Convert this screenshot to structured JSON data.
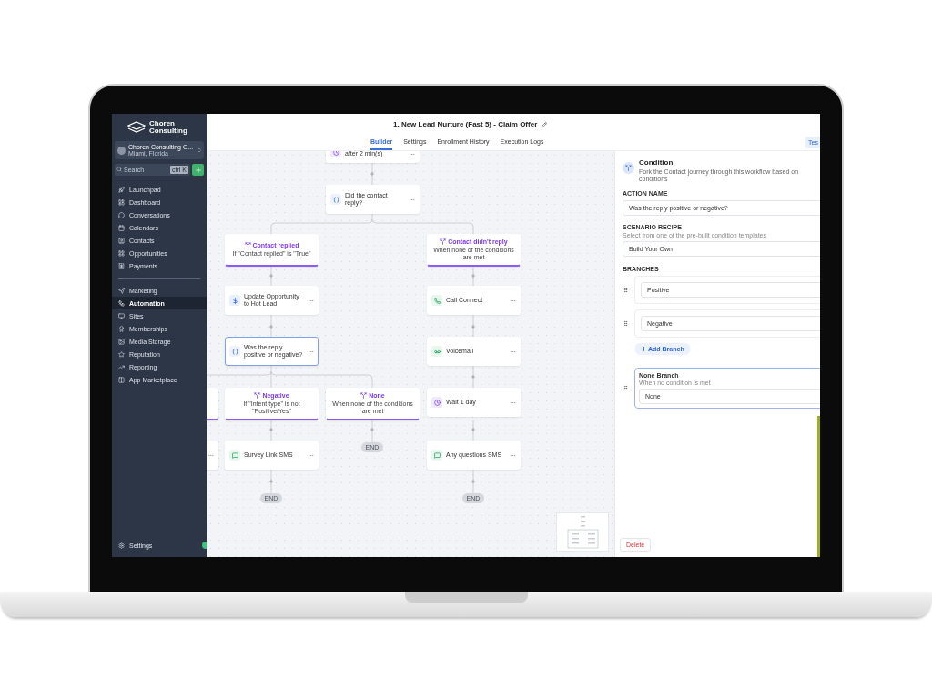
{
  "sidebar": {
    "brand": "Choren Consulting",
    "account": {
      "name": "Choren Consulting G...",
      "location": "Miami, Florida"
    },
    "search": {
      "placeholder": "Search",
      "shortcut": "ctrl K"
    },
    "nav_sections": [
      {
        "items": [
          {
            "label": "Launchpad",
            "selected": false
          },
          {
            "label": "Dashboard",
            "selected": false
          },
          {
            "label": "Conversations",
            "selected": false
          },
          {
            "label": "Calendars",
            "selected": false
          },
          {
            "label": "Contacts",
            "selected": false
          },
          {
            "label": "Opportunities",
            "selected": false
          },
          {
            "label": "Payments",
            "selected": false
          }
        ]
      },
      {
        "items": [
          {
            "label": "Marketing",
            "selected": false
          },
          {
            "label": "Automation",
            "selected": true
          },
          {
            "label": "Sites",
            "selected": false
          },
          {
            "label": "Memberships",
            "selected": false
          },
          {
            "label": "Media Storage",
            "selected": false
          },
          {
            "label": "Reputation",
            "selected": false
          },
          {
            "label": "Reporting",
            "selected": false
          },
          {
            "label": "App Marketplace",
            "selected": false
          }
        ]
      }
    ],
    "footer": {
      "label": "Settings"
    }
  },
  "header": {
    "title": "1. New Lead Nurture (Fast 5) - Claim Offer",
    "tabs": [
      {
        "label": "Builder",
        "selected": true
      },
      {
        "label": "Settings",
        "selected": false
      },
      {
        "label": "Enrollment History",
        "selected": false
      },
      {
        "label": "Execution Logs",
        "selected": false
      }
    ],
    "action": "Tes"
  },
  "canvas": {
    "nodes": [
      {
        "kind": "wait",
        "text": "after 2 min(s)",
        "selected": false
      },
      {
        "kind": "condition",
        "text": "Did the contact reply?",
        "selected": false
      },
      {
        "kind": "branch",
        "title": "Contact replied",
        "subtitle": "If \"Contact replied\" is \"True\"",
        "selected": false
      },
      {
        "kind": "branch",
        "title": "Contact didn't reply",
        "subtitle": "When none of the conditions are met",
        "selected": false
      },
      {
        "kind": "opportunity",
        "text": "Update Opportunity to Hot Lead",
        "selected": false
      },
      {
        "kind": "call",
        "text": "Call Connect",
        "selected": false
      },
      {
        "kind": "condition",
        "text": "Was the reply positive or negative?",
        "selected": true
      },
      {
        "kind": "voicemail",
        "text": "Voicemail",
        "selected": false
      },
      {
        "kind": "branch",
        "selected": false
      },
      {
        "kind": "branch",
        "title": "Negative",
        "subtitle": "If \"Intent type\" is not \"Positive/Yes\"",
        "selected": false
      },
      {
        "kind": "branch",
        "title": "None",
        "subtitle": "When none of the conditions are met",
        "selected": false
      },
      {
        "kind": "wait",
        "text": "Wait 1 day",
        "selected": false
      },
      {
        "kind": "sms",
        "selected": false
      },
      {
        "kind": "sms",
        "text": "Survey Link SMS",
        "selected": false
      },
      {
        "kind": "end",
        "text": "END"
      },
      {
        "kind": "sms",
        "text": "Any questions SMS",
        "selected": false
      },
      {
        "kind": "end",
        "text": "END"
      },
      {
        "kind": "end",
        "text": "END"
      }
    ]
  },
  "panel": {
    "title": "Condition",
    "description": "Fork the Contact journey through this workflow based on conditions",
    "action_name": {
      "label": "ACTION NAME",
      "value": "Was the reply positive or negative?"
    },
    "scenario_recipe": {
      "label": "SCENARIO RECIPE",
      "hint": "Select from one of the pre-built condition templates",
      "value": "Build Your Own"
    },
    "branches": {
      "label": "BRANCHES",
      "items": [
        {
          "value": "Positive"
        },
        {
          "value": "Negative"
        }
      ],
      "add_button": "Add Branch"
    },
    "none_branch": {
      "title": "None Branch",
      "description": "When no condition is met",
      "value": "None"
    },
    "delete_button": "Delete"
  }
}
